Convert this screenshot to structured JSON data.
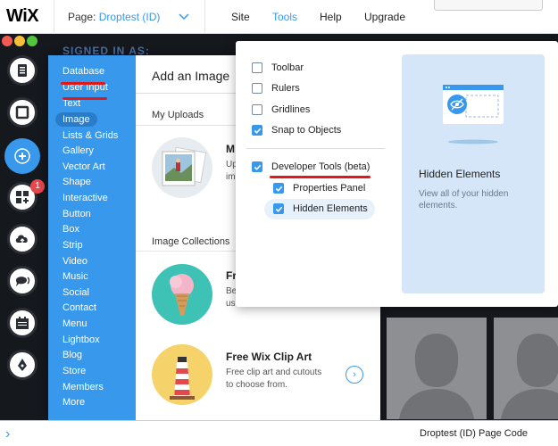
{
  "topbar": {
    "logo": "WiX",
    "page_label": "Page:",
    "page_value": "Droptest (ID)",
    "menu": [
      "Site",
      "Tools",
      "Help",
      "Upgrade"
    ]
  },
  "signed_in": "SIGNED IN AS:",
  "rail": {
    "badge_count": "1",
    "buttons": [
      "pages-icon",
      "background-icon",
      "add-icon",
      "apps-icon",
      "upload-icon",
      "chat-icon",
      "calendar-icon",
      "pen-icon"
    ]
  },
  "add_panel": {
    "categories": [
      "Database",
      "User Input",
      "Text",
      "Image",
      "Lists & Grids",
      "Gallery",
      "Vector Art",
      "Shape",
      "Interactive",
      "Button",
      "Box",
      "Strip",
      "Video",
      "Music",
      "Social",
      "Contact",
      "Menu",
      "Lightbox",
      "Blog",
      "Store",
      "Members",
      "More"
    ],
    "selected": "Image",
    "title": "Add an Image",
    "my_uploads": "My Uploads",
    "upload_item": {
      "title": "M",
      "desc1": "Up",
      "desc2": "im"
    },
    "image_collections": "Image Collections",
    "collection_item": {
      "title": "Fr",
      "desc1": "Be",
      "desc2": "us"
    },
    "clipart": {
      "title": "Free Wix Clip Art",
      "desc1": "Free clip art and cutouts",
      "desc2": "to choose from."
    }
  },
  "tools_menu": {
    "options": [
      {
        "label": "Toolbar",
        "checked": false
      },
      {
        "label": "Rulers",
        "checked": false
      },
      {
        "label": "Gridlines",
        "checked": false
      },
      {
        "label": "Snap to Objects",
        "checked": true
      }
    ],
    "developer": {
      "label": "Developer Tools (beta)",
      "checked": true
    },
    "sub_options": [
      {
        "label": "Properties Panel",
        "checked": true
      },
      {
        "label": "Hidden Elements",
        "checked": true
      }
    ],
    "info_title": "Hidden Elements",
    "info_desc": "View all of your hidden elements."
  },
  "bottombar": {
    "chevron": "›",
    "text": "Droptest (ID) Page Code"
  },
  "colors": {
    "accent": "#3899ec",
    "annotation": "#e01818",
    "panel_info_bg": "#d5e6f8"
  }
}
